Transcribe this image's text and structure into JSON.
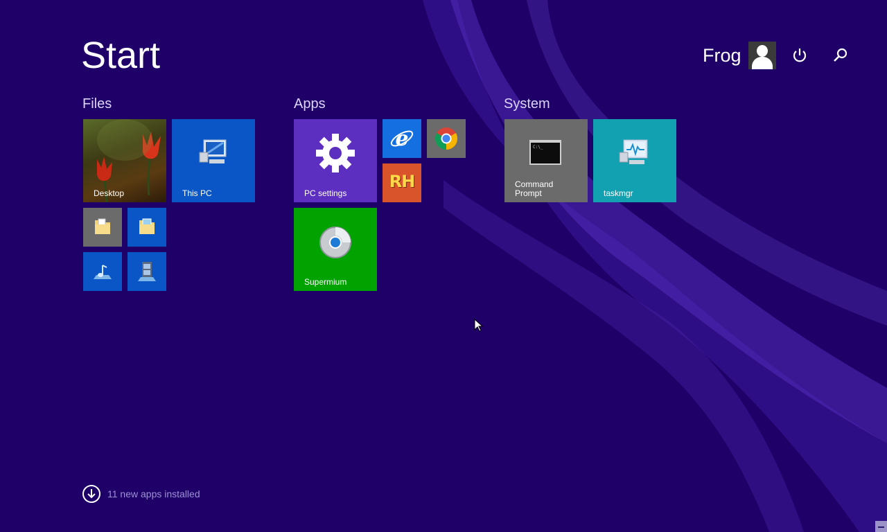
{
  "screen": {
    "title": "Start"
  },
  "user": {
    "name": "Frog"
  },
  "groups": {
    "files": "Files",
    "apps": "Apps",
    "system": "System"
  },
  "tiles": {
    "desktop": "Desktop",
    "this_pc": "This PC",
    "pc_settings": "PC settings",
    "supermium": "Supermium",
    "command_prompt_line1": "Command",
    "command_prompt_line2": "Prompt",
    "taskmgr": "taskmgr",
    "rh": "RH"
  },
  "footer": {
    "text": "11 new apps installed"
  },
  "colors": {
    "background": "#1f0068",
    "tile_blue": "#0a56c6",
    "tile_purple": "#5d2fc0",
    "tile_green": "#00a300",
    "tile_orange": "#d9532b",
    "tile_grey": "#6b6b6b",
    "tile_teal": "#11a1b0",
    "tile_ie_blue": "#1470e0"
  },
  "icons": {
    "power": "power-icon",
    "search": "search-icon",
    "settings": "gear-icon",
    "computer": "computer-icon",
    "ie": "internet-explorer-icon",
    "chrome": "chrome-icon",
    "folder": "folder-icon",
    "music": "music-icon",
    "video": "video-icon",
    "cmd": "command-prompt-icon",
    "monitor": "task-manager-icon",
    "supermium": "supermium-icon",
    "download": "download-arrow-icon"
  }
}
